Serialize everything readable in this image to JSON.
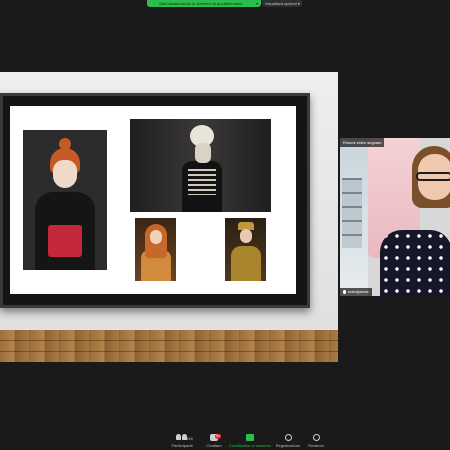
{
  "banner": {
    "share_status": "Stai visualizzando lo schermo di quoththemaus",
    "view_options": "Visualizza opzioni"
  },
  "participant_tile": {
    "top_label": "Rinomi video segnato",
    "name": "mandyshae"
  },
  "toolbar": {
    "participants_label": "Partecipanti",
    "participants_count": "194",
    "chat_label": "Chattare",
    "chat_badge": "54",
    "share_label": "Condividere lo schermo",
    "record_label": "Registrazione",
    "reactions_label": "Reazioni"
  },
  "colors": {
    "share_green": "#2dbd4e",
    "badge_red": "#e02828",
    "background": "#1a1a1a"
  }
}
